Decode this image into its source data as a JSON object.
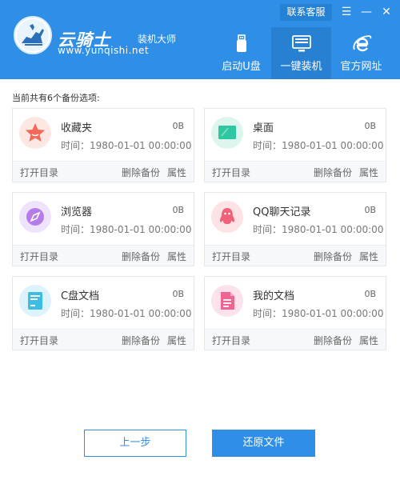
{
  "header": {
    "brand_name": "云骑士",
    "brand_suffix": "装机大师",
    "brand_url": "www.yunqishi.net",
    "support_label": "联系客服",
    "menu_icon": "☰",
    "minimize_icon": "—",
    "close_icon": "✕",
    "accent_color": "#2f8ee5"
  },
  "nav": {
    "items": [
      {
        "label": "启动U盘",
        "icon": "usb-icon"
      },
      {
        "label": "一键装机",
        "icon": "monitor-icon",
        "active": true
      },
      {
        "label": "官方网址",
        "icon": "ie-icon"
      }
    ]
  },
  "main": {
    "title": "当前共有6个备份选项:"
  },
  "cards": [
    {
      "name": "收藏夹",
      "size": "0B",
      "time": "时间：1980-01-01 00:00:00",
      "open": "打开目录",
      "delete": "删除备份",
      "props": "属性",
      "icon": "star-icon",
      "icon_color": "#f26a56"
    },
    {
      "name": "桌面",
      "size": "0B",
      "time": "时间：1980-01-01 00:00:00",
      "open": "打开目录",
      "delete": "删除备份",
      "props": "属性",
      "icon": "desktop-icon",
      "icon_color": "#2fc7a2"
    },
    {
      "name": "浏览器",
      "size": "0B",
      "time": "时间：1980-01-01 00:00:00",
      "open": "打开目录",
      "delete": "删除备份",
      "props": "属性",
      "icon": "compass-icon",
      "icon_color": "#b57be8"
    },
    {
      "name": "QQ聊天记录",
      "size": "0B",
      "time": "时间：1980-01-01 00:00:00",
      "open": "打开目录",
      "delete": "删除备份",
      "props": "属性",
      "icon": "penguin-icon",
      "icon_color": "#f2617a"
    },
    {
      "name": "C盘文档",
      "size": "0B",
      "time": "时间：1980-01-01 00:00:00",
      "open": "打开目录",
      "delete": "删除备份",
      "props": "属性",
      "icon": "drive-icon",
      "icon_color": "#3dbde3"
    },
    {
      "name": "我的文档",
      "size": "0B",
      "time": "时间：1980-01-01 00:00:00",
      "open": "打开目录",
      "delete": "删除备份",
      "props": "属性",
      "icon": "document-icon",
      "icon_color": "#f06590"
    }
  ],
  "footer": {
    "prev_label": "上一步",
    "restore_label": "还原文件"
  }
}
